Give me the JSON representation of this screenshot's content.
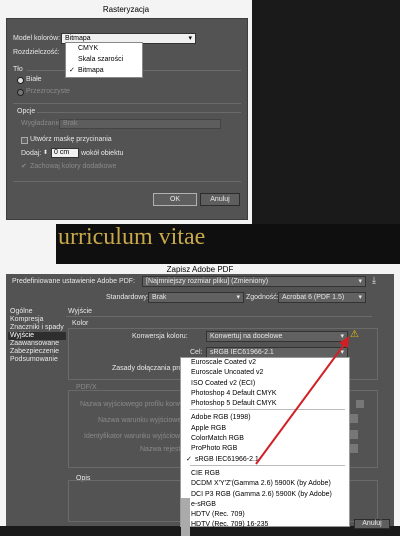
{
  "raster": {
    "title": "Rasteryzacja",
    "color_model_label": "Model kolorów:",
    "color_model_value": "Bitmapa",
    "resolution_label": "Rozdzielczość:",
    "color_model_options": [
      "CMYK",
      "Skala szarości",
      "Bitmapa"
    ],
    "background_label": "Tło",
    "bg_white": "Białe",
    "bg_transparent": "Przezroczyste",
    "options_label": "Opcje",
    "anti_alias_label": "Wygładzanie:",
    "anti_alias_value": "Brak",
    "clip_mask_label": "Utwórz maskę przycinania",
    "add_label": "Dodaj:",
    "add_value": "0 cm",
    "add_suffix": "wokół obiektu",
    "spot_colors_label": "Zachowaj kolory dodatkowe",
    "ok": "OK",
    "cancel": "Anuluj"
  },
  "banner_text": "urriculum vitae",
  "pdf": {
    "title": "Zapisz Adobe PDF",
    "preset_label": "Predefiniowane ustawienie Adobe PDF:",
    "preset_value": "[Najmniejszy rozmiar pliku] (Zmieniony)",
    "standard_label": "Standardowy:",
    "standard_value": "Brak",
    "compat_label": "Zgodność:",
    "compat_value": "Acrobat 6 (PDF 1.5)",
    "sidebar": [
      "Ogólne",
      "Kompresja",
      "Znaczniki i spady",
      "Wyjście",
      "Zaawansowane",
      "Zabezpieczenie",
      "Podsumowanie"
    ],
    "section_title": "Wyjście",
    "color_group": "Kolor",
    "conversion_label": "Konwersja koloru:",
    "conversion_value": "Konwertuj na docelowe",
    "target_label": "Cel:",
    "target_value": "sRGB IEC61966-2.1",
    "profile_policy_label": "Zasady dołączania profilu:",
    "pdfx_label": "PDF/X",
    "pdfx_rows": [
      "Nazwa wyjściowego profilu konwersji:",
      "Nazwa warunku wyjściowego:",
      "Identyfikator warunku wyjściowego:",
      "Nazwa rejestru:"
    ],
    "desc_label": "Opis",
    "cancel": "Anuluj",
    "target_options": [
      "Euroscale Coated v2",
      "Euroscale Uncoated v2",
      "ISO Coated v2 (ECI)",
      "Photoshop 4 Default CMYK",
      "Photoshop 5 Default CMYK",
      "---",
      "Adobe RGB (1998)",
      "Apple RGB",
      "ColorMatch RGB",
      "ProPhoto RGB",
      "sRGB IEC61966-2.1",
      "---",
      "CIE RGB",
      "DCDM X'Y'Z'(Gamma 2.6) 5900K (by Adobe)",
      "DCI P3 RGB (Gamma 2.6) 5900K (by Adobe)",
      "e-sRGB",
      "HDTV (Rec. 709)",
      "HDTV (Rec. 709) 16-235"
    ],
    "target_selected_index": 10,
    "accent_red": "#d21f26",
    "warning_color": "#f2c200"
  }
}
